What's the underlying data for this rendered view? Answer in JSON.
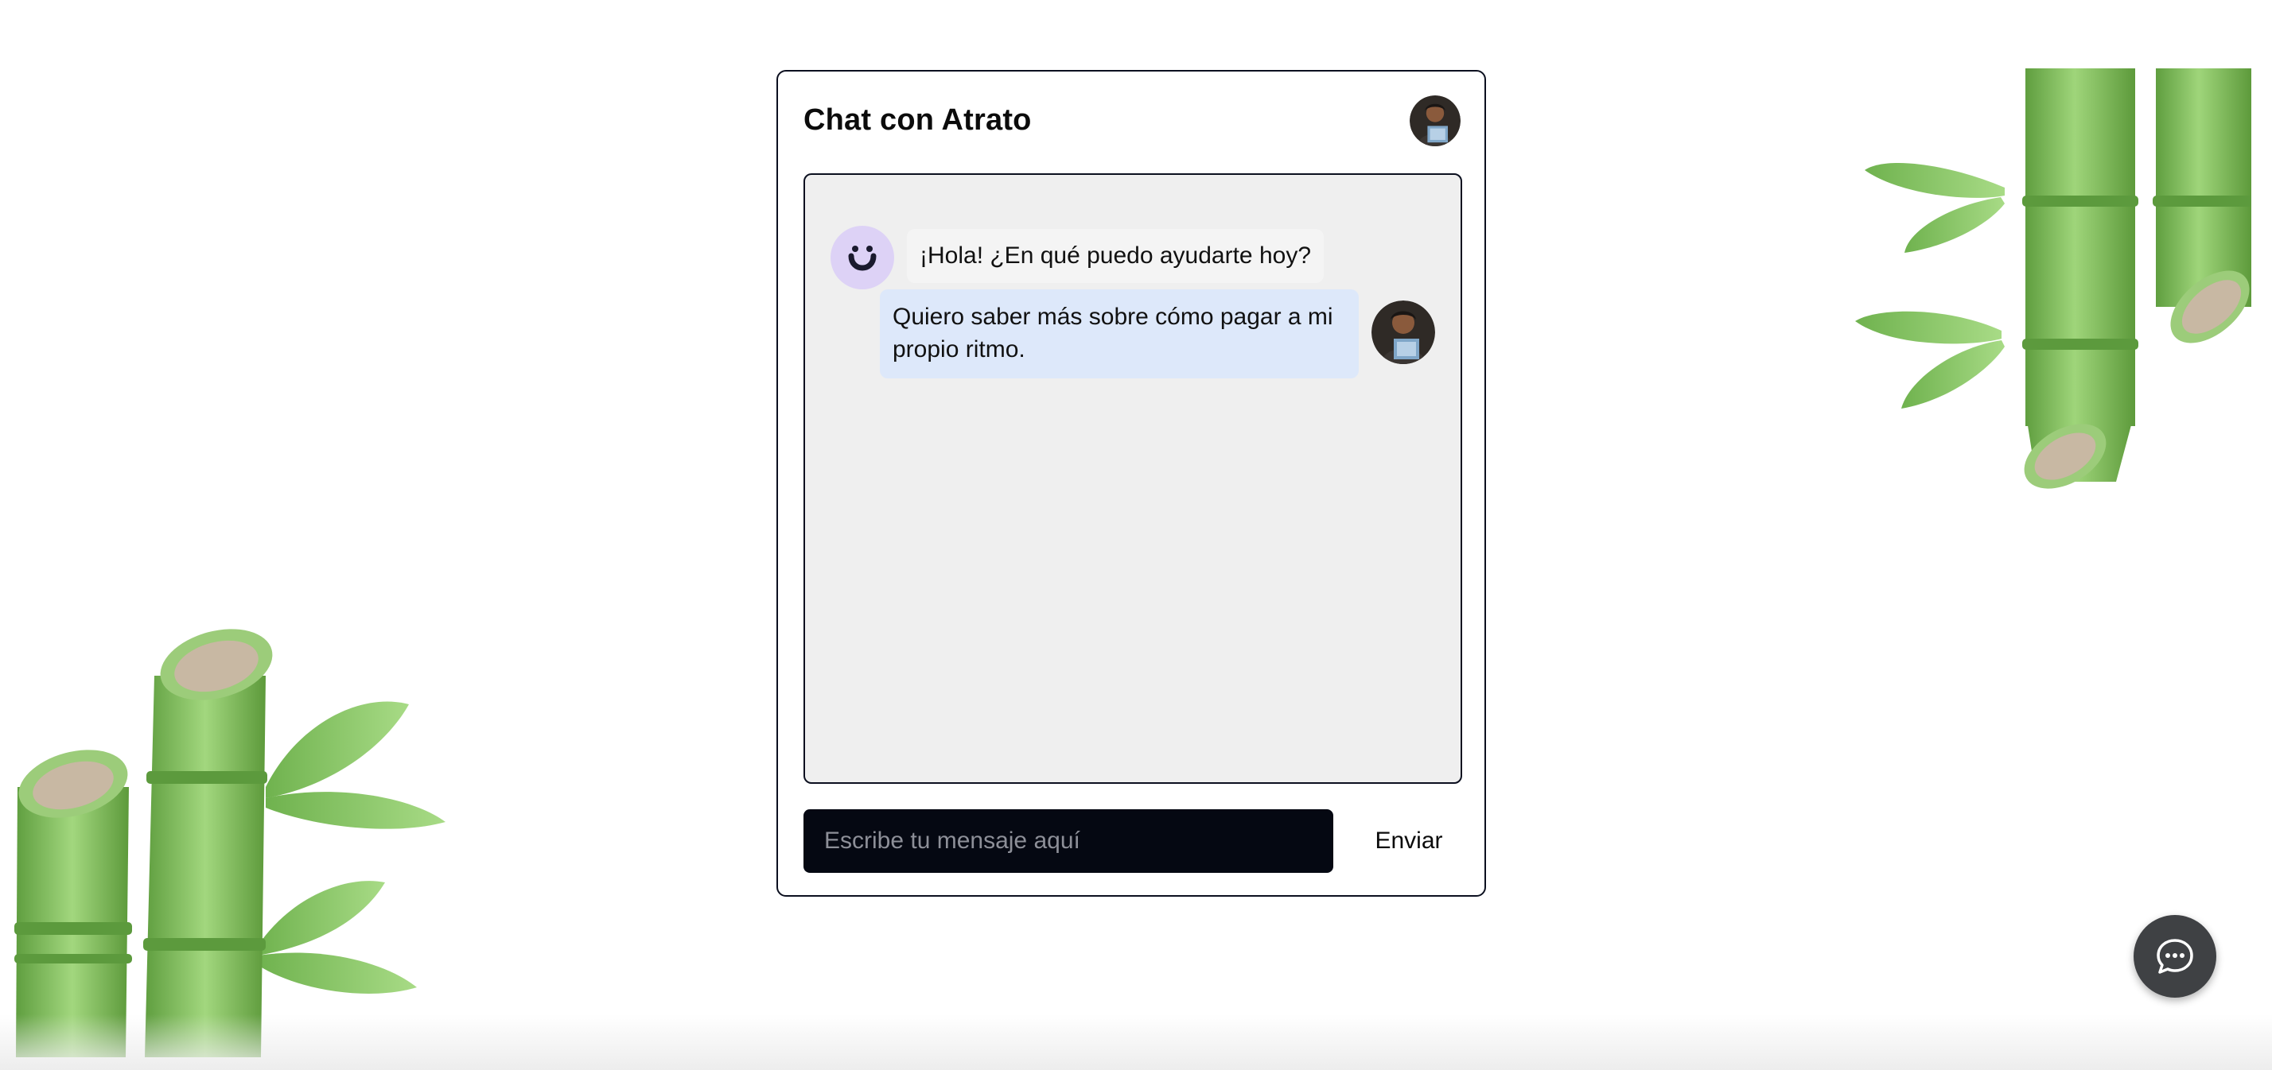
{
  "chat": {
    "title": "Chat con Atrato",
    "messages": [
      {
        "sender": "bot",
        "text": "¡Hola! ¿En qué puedo ayudarte hoy?"
      },
      {
        "sender": "user",
        "text": "Quiero saber más sobre cómo pagar a mi propio ritmo."
      }
    ],
    "input": {
      "placeholder": "Escribe tu mensaje aquí",
      "value": ""
    },
    "send_label": "Enviar"
  },
  "icons": {
    "bot_avatar": "smile-face-icon",
    "user_avatar": "user-photo-avatar",
    "fab": "chat-bubble-icon"
  },
  "colors": {
    "card_border": "#0b0f1f",
    "message_area_bg": "#efefef",
    "bot_avatar_bg": "#ddd2f6",
    "user_bubble_bg": "#dde8fa",
    "input_bg": "#050812",
    "fab_bg": "#3f4144",
    "bamboo_green": "#7dbf5a"
  }
}
